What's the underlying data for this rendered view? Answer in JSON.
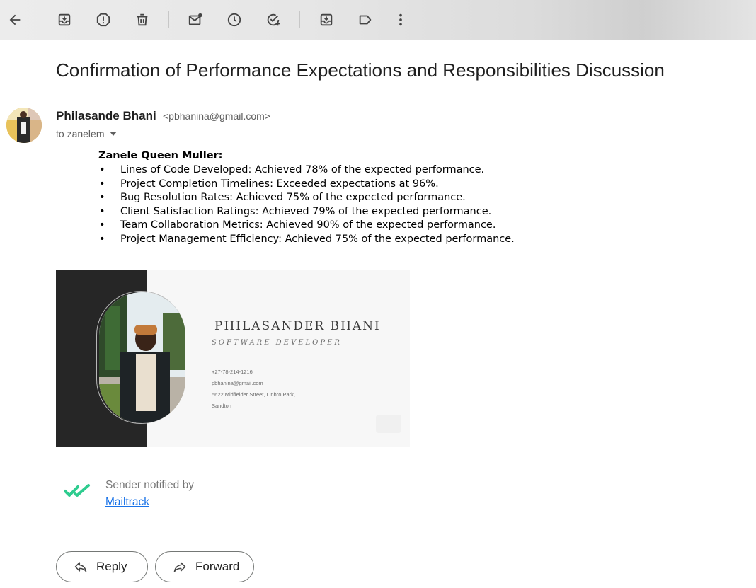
{
  "toolbar": {
    "icons": [
      "back-arrow-icon",
      "archive-icon",
      "report-spam-icon",
      "delete-icon",
      "mark-unread-icon",
      "snooze-icon",
      "add-task-icon",
      "move-to-icon",
      "label-icon",
      "more-vert-icon"
    ]
  },
  "email": {
    "subject": "Confirmation of Performance Expectations and Responsibilities Discussion",
    "sender_name": "Philasande Bhani",
    "sender_email": "<pbhanina@gmail.com>",
    "to_line": "to zanelem",
    "body": {
      "heading": "Zanele Queen Muller:",
      "bullet_char": "•",
      "items": [
        "Lines of Code Developed: Achieved 78% of the expected performance.",
        "Project Completion Timelines: Exceeded expectations at 96%.",
        "Bug Resolution Rates: Achieved 75% of the expected performance.",
        "Client Satisfaction Ratings: Achieved 79% of the expected performance.",
        "Team Collaboration Metrics: Achieved 90% of the expected performance.",
        "Project Management Efficiency: Achieved 75% of the expected performance."
      ]
    }
  },
  "business_card": {
    "name": "PHILASANDER BHANI",
    "role": "SOFTWARE DEVELOPER",
    "phone": "+27-78-214-1216",
    "email": "pbhanina@gmail.com",
    "address_line1": "5622 Midfielder Street, Linbro Park,",
    "address_line2": "Sandton"
  },
  "mailtrack": {
    "text": "Sender notified by",
    "link": "Mailtrack",
    "check_color": "#2ecc8f"
  },
  "actions": {
    "reply": "Reply",
    "forward": "Forward"
  }
}
